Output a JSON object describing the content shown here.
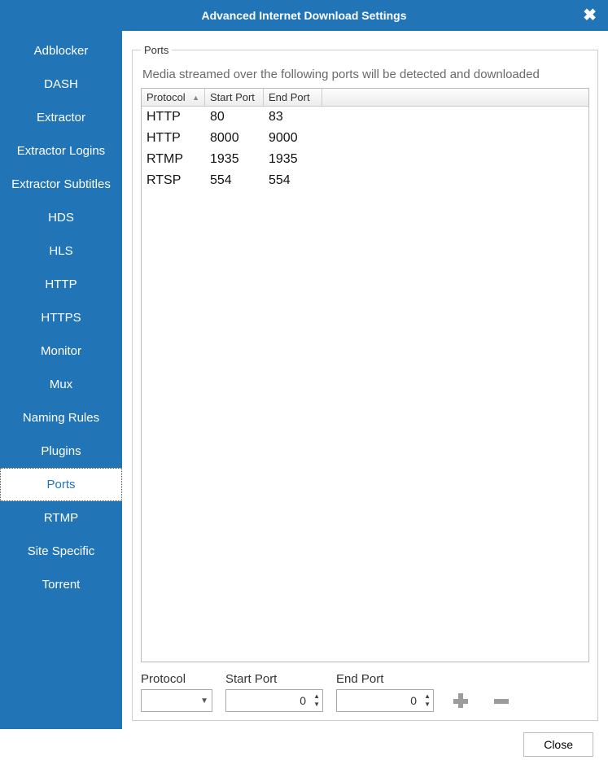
{
  "title": "Advanced Internet Download Settings",
  "sidebar": {
    "items": [
      {
        "label": "Adblocker"
      },
      {
        "label": "DASH"
      },
      {
        "label": "Extractor"
      },
      {
        "label": "Extractor Logins"
      },
      {
        "label": "Extractor Subtitles"
      },
      {
        "label": "HDS"
      },
      {
        "label": "HLS"
      },
      {
        "label": "HTTP"
      },
      {
        "label": "HTTPS"
      },
      {
        "label": "Monitor"
      },
      {
        "label": "Mux"
      },
      {
        "label": "Naming Rules"
      },
      {
        "label": "Plugins"
      },
      {
        "label": "Ports"
      },
      {
        "label": "RTMP"
      },
      {
        "label": "Site Specific"
      },
      {
        "label": "Torrent"
      }
    ],
    "selected_index": 13
  },
  "group": {
    "legend": "Ports",
    "description": "Media streamed over the following ports will be detected and downloaded",
    "columns": {
      "protocol": "Protocol",
      "start": "Start Port",
      "end": "End Port"
    },
    "rows": [
      {
        "protocol": "HTTP",
        "start": "80",
        "end": "83"
      },
      {
        "protocol": "HTTP",
        "start": "8000",
        "end": "9000"
      },
      {
        "protocol": "RTMP",
        "start": "1935",
        "end": "1935"
      },
      {
        "protocol": "RTSP",
        "start": "554",
        "end": "554"
      }
    ]
  },
  "form": {
    "protocol_label": "Protocol",
    "protocol_value": "",
    "start_label": "Start Port",
    "start_value": "0",
    "end_label": "End Port",
    "end_value": "0"
  },
  "footer": {
    "close": "Close"
  }
}
